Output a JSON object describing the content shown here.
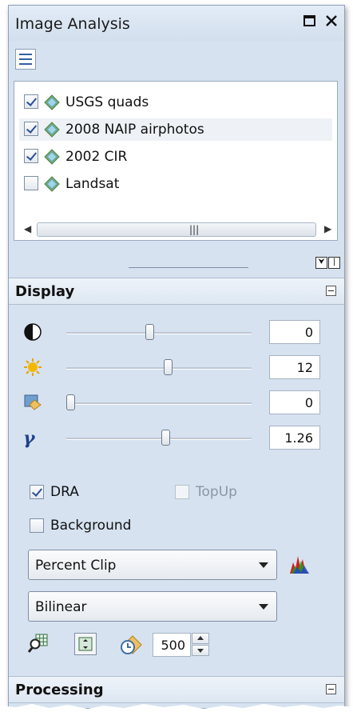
{
  "window": {
    "title": "Image Analysis"
  },
  "toolbar": {
    "list_options_icon": "list-options-icon"
  },
  "layers": [
    {
      "label": "USGS quads",
      "checked": true
    },
    {
      "label": "2008 NAIP airphotos",
      "checked": true
    },
    {
      "label": "2002 CIR",
      "checked": true
    },
    {
      "label": "Landsat",
      "checked": false
    }
  ],
  "display": {
    "title": "Display",
    "sliders": [
      {
        "name": "contrast",
        "icon": "contrast-icon",
        "value": "0",
        "position": 0.45
      },
      {
        "name": "brightness",
        "icon": "brightness-icon",
        "value": "12",
        "position": 0.55
      },
      {
        "name": "transparency",
        "icon": "transparency-icon",
        "value": "0",
        "position": 0.0
      },
      {
        "name": "gamma",
        "icon": "gamma-icon",
        "value": "1.26",
        "position": 0.54
      }
    ],
    "gamma_glyph": "γ",
    "dra_label": "DRA",
    "dra_checked": true,
    "topup_label": "TopUp",
    "topup_checked": false,
    "background_label": "Background",
    "background_checked": false,
    "stretch_selected": "Percent Clip",
    "resample_selected": "Bilinear",
    "time_value": "500"
  },
  "processing": {
    "title": "Processing"
  },
  "colors": {
    "accent": "#2a4f9a",
    "panel_bg": "#d6e2f0"
  }
}
